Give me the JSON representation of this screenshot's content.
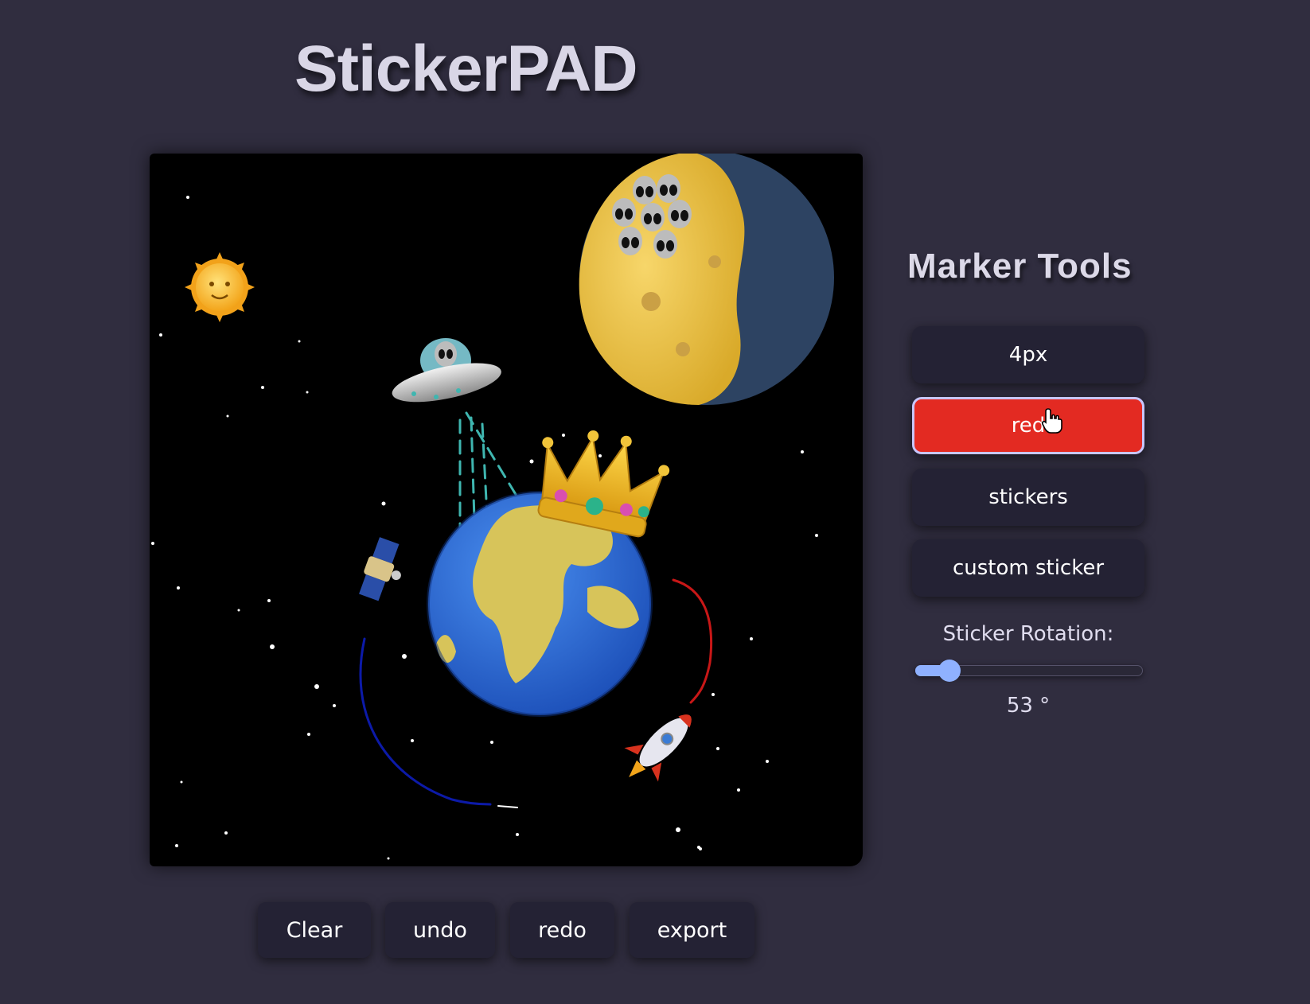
{
  "app": {
    "title": "StickerPAD"
  },
  "canvas": {
    "stickers": [
      "sun-sticker",
      "alien-sticker",
      "moon-sticker",
      "ufo-sticker",
      "crown-sticker",
      "earth-sticker",
      "satellite-sticker",
      "rocket-sticker"
    ]
  },
  "marker_tools": {
    "title": "Marker Tools",
    "size_label": "4px",
    "color_label": "red",
    "stickers_label": "stickers",
    "custom_sticker_label": "custom sticker",
    "rotation_label": "Sticker Rotation:",
    "rotation_value": "53 °",
    "rotation_fraction": 0.15,
    "active_color": "#e32a22",
    "slider_color": "#8fb1ff"
  },
  "actions": {
    "clear_label": "Clear",
    "undo_label": "undo",
    "redo_label": "redo",
    "export_label": "export"
  },
  "colors": {
    "background": "#302d3f",
    "button": "#242234",
    "canvas": "#000000"
  }
}
